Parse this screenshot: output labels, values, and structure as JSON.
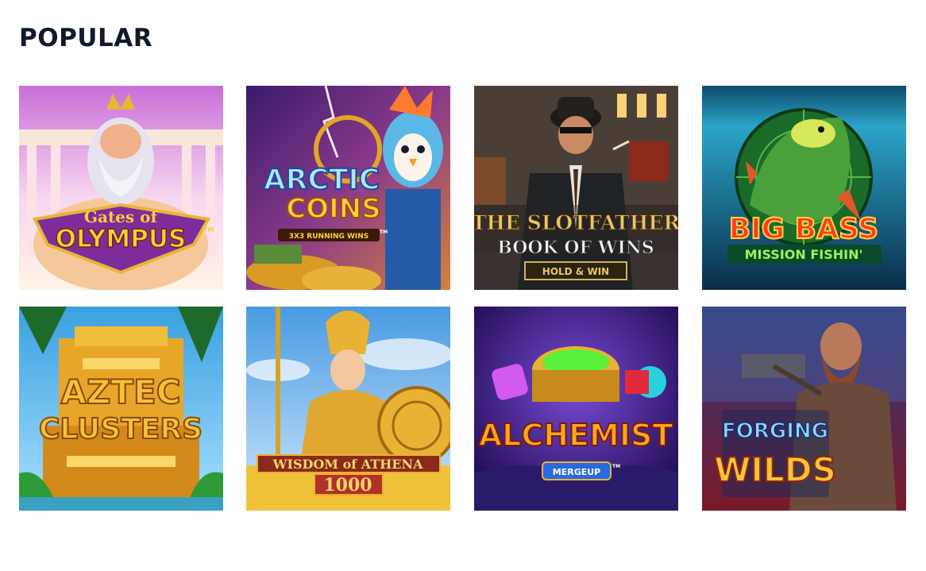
{
  "section": {
    "title": "POPULAR"
  },
  "games": [
    {
      "name": "gates-of-olympus",
      "line1": "Gates of",
      "line2": "OLYMPUS",
      "mark": "TM"
    },
    {
      "name": "arctic-coins",
      "line1": "ARCTIC",
      "line2": "COINS",
      "badge": "3X3 RUNNING WINS",
      "mark": "TM"
    },
    {
      "name": "the-slotfather",
      "line1": "THE SLOTFATHER",
      "line2": "BOOK OF WINS",
      "badge": "HOLD & WIN"
    },
    {
      "name": "big-bass-mission-fishin",
      "line1": "BIG BASS",
      "line2": "MISSION FISHIN'"
    },
    {
      "name": "aztec-clusters",
      "line1": "AZTEC",
      "line2": "CLUSTERS"
    },
    {
      "name": "wisdom-of-athena",
      "line1": "WISDOM of ATHENA",
      "line2": "1000"
    },
    {
      "name": "alchemist-merge-up",
      "line1": "ALCHEMIST",
      "badge": "MERGEUP",
      "mark": "TM"
    },
    {
      "name": "forging-wilds",
      "line1": "FORGING",
      "line2": "WILDS"
    }
  ]
}
